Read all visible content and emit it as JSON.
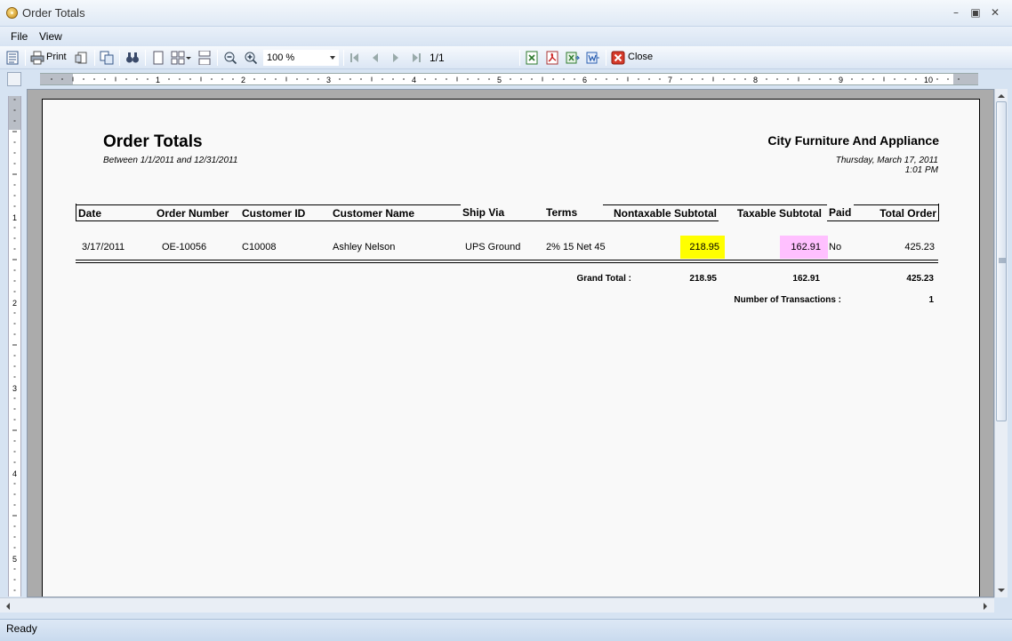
{
  "window": {
    "title": "Order Totals"
  },
  "menu": {
    "items": [
      "File",
      "View"
    ]
  },
  "toolbar": {
    "print_label": "Print",
    "zoom_value": "100 %",
    "page_indicator": "1/1",
    "close_label": "Close"
  },
  "ruler": {
    "h_numbers": [
      "1",
      "2",
      "3",
      "4",
      "5",
      "6",
      "7",
      "8",
      "9",
      "10"
    ],
    "v_numbers": [
      "1",
      "2",
      "3",
      "4",
      "5"
    ]
  },
  "report": {
    "title": "Order Totals",
    "subtitle": "Between 1/1/2011 and 12/31/2011",
    "company": "City Furniture And Appliance",
    "print_date": "Thursday, March 17, 2011",
    "print_time": "1:01 PM",
    "columns": [
      "Date",
      "Order Number",
      "Customer ID",
      "Customer Name",
      "Ship Via",
      "Terms",
      "Nontaxable Subtotal",
      "Taxable Subtotal",
      "Paid",
      "Total Order"
    ],
    "rows": [
      {
        "date": "3/17/2011",
        "order_number": "OE-10056",
        "customer_id": "C10008",
        "customer_name": "Ashley Nelson",
        "ship_via": "UPS Ground",
        "terms": "2% 15 Net 45",
        "nontaxable": "218.95",
        "taxable": "162.91",
        "paid": "No",
        "total": "425.23"
      }
    ],
    "grand_total_label": "Grand Total :",
    "grand_nontaxable": "218.95",
    "grand_taxable": "162.91",
    "grand_total": "425.23",
    "transactions_label": "Number of Transactions :",
    "transactions_count": "1",
    "highlight_colors": {
      "nontaxable": "#ffff00",
      "taxable": "#ffc0ff"
    }
  },
  "status": {
    "text": "Ready"
  }
}
